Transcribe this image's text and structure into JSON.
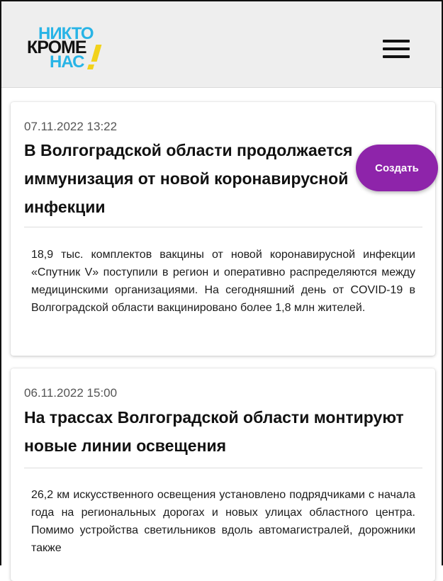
{
  "header": {
    "logo": {
      "line1": "НИКТО",
      "line2": "КРОМЕ",
      "line3": "НАС",
      "accent_color": "#28b4e6",
      "mark_color": "#f2d21c"
    },
    "menu_icon": "hamburger-menu-icon"
  },
  "fab": {
    "label": "Создать",
    "color": "#8e24aa"
  },
  "news": [
    {
      "date": "07.11.2022 13:22",
      "title": "В Волгоградской области продолжается иммунизация от новой коронавирусной инфекции",
      "text": "18,9 тыс. комплектов вакцины от новой коронавирусной инфекции «Спутник V» поступили в регион и оперативно распределяются между медицинскими организациями. На сегодняшний день от COVID-19 в Волгоградской области вакцинировано более 1,8 млн жителей."
    },
    {
      "date": "06.11.2022 15:00",
      "title": "На трассах Волгоградской области монтируют новые линии освещения",
      "text": "26,2 км искусственного освещения установлено подрядчиками с начала года на региональных дорогах и новых улицах областного центра. Помимо устройства светильников вдоль автомагистралей, дорожники также"
    }
  ]
}
